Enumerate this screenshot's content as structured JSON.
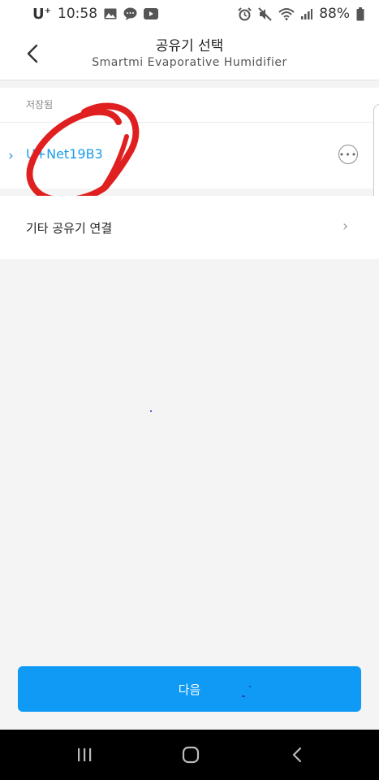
{
  "status_bar": {
    "carrier": "U",
    "carrier_superscript": "+",
    "time": "10:58",
    "battery": "88%",
    "left_icons": [
      "image-icon",
      "chat-bubble-icon",
      "youtube-icon"
    ],
    "right_icons": [
      "alarm-icon",
      "mute-icon",
      "wifi-icon",
      "signal-icon",
      "battery-icon"
    ]
  },
  "header": {
    "title": "공유기 선택",
    "subtitle": "Smartmi Evaporative Humidifier"
  },
  "saved_section": {
    "label": "저장됨",
    "networks": [
      {
        "name": "U+Net19B3",
        "selected": true
      }
    ]
  },
  "other_router": {
    "label": "기타 공유기 연결"
  },
  "next_button": {
    "label": "다음"
  },
  "colors": {
    "accent": "#0f9bf5",
    "link": "#1a9be8",
    "annotation": "#e02020",
    "background": "#f4f4f4"
  }
}
